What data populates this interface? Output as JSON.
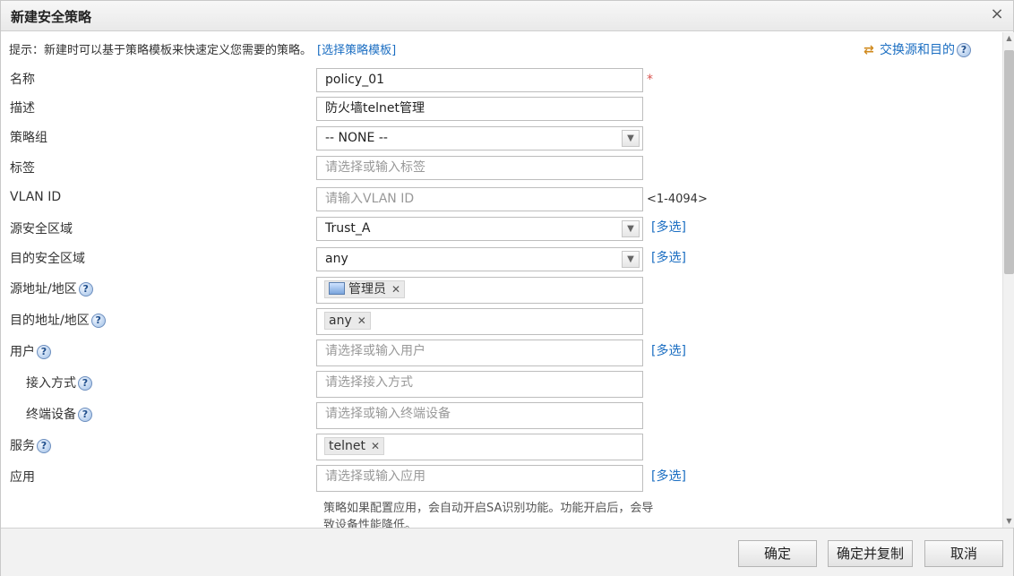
{
  "dialog": {
    "title": "新建安全策略",
    "close_icon": "×"
  },
  "hint": {
    "text": "提示：新建时可以基于策略模板来快速定义您需要的策略。",
    "link": "[选择策略模板]"
  },
  "swap": {
    "label": "交换源和目的",
    "icon": "⇄"
  },
  "help_glyph": "?",
  "form": {
    "name": {
      "label": "名称",
      "value": "policy_01",
      "required_mark": "*"
    },
    "desc": {
      "label": "描述",
      "value": "防火墙telnet管理"
    },
    "group": {
      "label": "策略组",
      "value": "-- NONE --"
    },
    "tags": {
      "label": "标签",
      "placeholder": "请选择或输入标签"
    },
    "vlan": {
      "label": "VLAN ID",
      "placeholder": "请输入VLAN ID",
      "range": "<1-4094>"
    },
    "src_zone": {
      "label": "源安全区域",
      "value": "Trust_A",
      "multi": "[多选]"
    },
    "dst_zone": {
      "label": "目的安全区域",
      "value": "any",
      "multi": "[多选]"
    },
    "src_addr": {
      "label": "源地址/地区",
      "tag": "管理员"
    },
    "dst_addr": {
      "label": "目的地址/地区",
      "tag": "any"
    },
    "user": {
      "label": "用户",
      "placeholder": "请选择或输入用户",
      "multi": "[多选]"
    },
    "access": {
      "label": "接入方式",
      "placeholder": "请选择接入方式"
    },
    "terminal": {
      "label": "终端设备",
      "placeholder": "请选择或输入终端设备"
    },
    "service": {
      "label": "服务",
      "tag": "telnet"
    },
    "app": {
      "label": "应用",
      "placeholder": "请选择或输入应用",
      "multi": "[多选]"
    },
    "app_note": "策略如果配置应用，会自动开启SA识别功能。功能开启后，会导致设备性能降低。"
  },
  "footer": {
    "ok": "确定",
    "ok_copy": "确定并复制",
    "cancel": "取消"
  },
  "icons": {
    "close": "close-icon",
    "swap": "swap-icon",
    "help": "help-icon",
    "dropdown": "chevron-down-icon",
    "remove": "remove-tag-icon",
    "user_group": "monitor-icon"
  },
  "colors": {
    "link": "#1b6ec2",
    "required": "#d9534f",
    "placeholder": "#999999"
  }
}
